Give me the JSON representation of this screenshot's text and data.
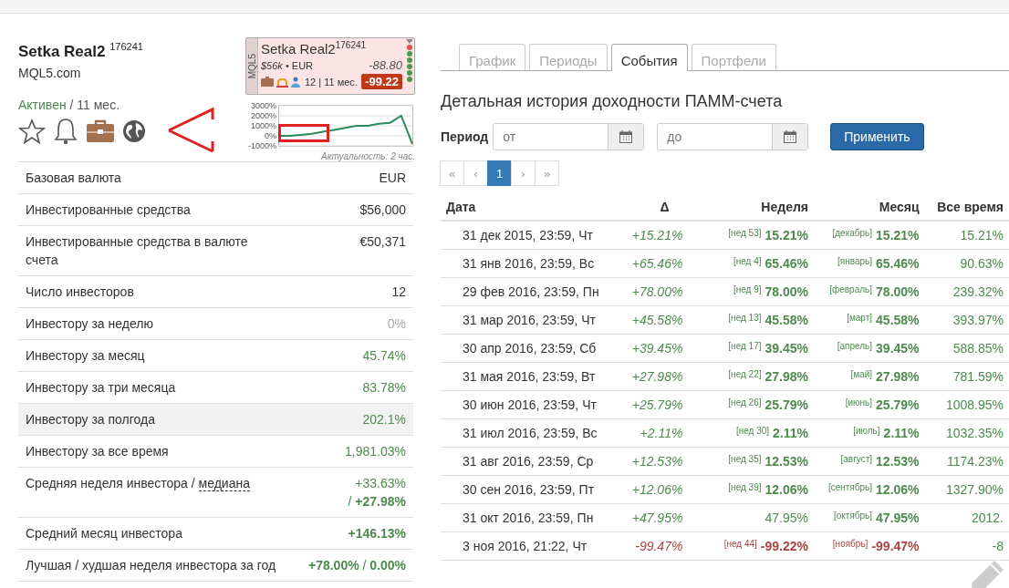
{
  "account": {
    "name": "Setka Real2",
    "number": "176241",
    "site": "MQL5.com",
    "status": "Активен",
    "age": " / 11 мес."
  },
  "widget": {
    "vendor": "MQL5",
    "name": "Setka Real2",
    "number": "176241",
    "funds": "$56k",
    "currency": " • EUR",
    "value": "-88.80",
    "investors": "12 | 11 мес.",
    "result": "-99.22",
    "signals": [
      {
        "color": "#d9534f"
      },
      {
        "color": "#4a9a4a"
      },
      {
        "color": "#4a9a4a"
      },
      {
        "color": "#4a9a4a"
      },
      {
        "color": "#4a9a4a"
      },
      {
        "color": "#4a9a4a"
      }
    ],
    "chart_data": {
      "type": "line",
      "yticks": [
        {
          "value": 3000,
          "label": "3000%"
        },
        {
          "value": 2000,
          "label": "2000%"
        },
        {
          "value": 1000,
          "label": "1000%"
        },
        {
          "value": 0,
          "label": "0%"
        },
        {
          "value": -1000,
          "label": "-1000%"
        }
      ],
      "ylim": [
        -1000,
        3000
      ],
      "grid": true,
      "series": [
        {
          "color": "#2e8b57",
          "values": [
            0,
            0,
            100,
            200,
            400,
            600,
            800,
            1000,
            1000,
            1200,
            1300,
            2000,
            -800
          ]
        }
      ]
    },
    "caption": "Актуальность: 2 час."
  },
  "stats": [
    {
      "label": "Базовая валюта",
      "value": "EUR",
      "kind": "plain",
      "highlighted": false
    },
    {
      "label": "Инвестированные средства",
      "value": "$56,000",
      "kind": "plain",
      "highlighted": false
    },
    {
      "label": "Инвестированные средства в валюте счета",
      "value": "€50,371",
      "kind": "plain",
      "highlighted": false
    },
    {
      "label": "Число инвесторов",
      "value": "12",
      "kind": "plain",
      "highlighted": false
    },
    {
      "label": "Инвестору за неделю",
      "value": "0%",
      "kind": "muted",
      "highlighted": false
    },
    {
      "label": "Инвестору за месяц",
      "value": "45.74%",
      "kind": "green",
      "highlighted": false
    },
    {
      "label": "Инвестору за три месяца",
      "value": "83.78%",
      "kind": "green",
      "highlighted": false
    },
    {
      "label": "Инвестору за полгода",
      "value": "202.1%",
      "kind": "green",
      "highlighted": true
    },
    {
      "label": "Инвестору за все время",
      "value": "1,981.03%",
      "kind": "green",
      "highlighted": false
    },
    {
      "label": "Средняя неделя инвестора / ",
      "link": "медиана",
      "value": "+33.63%",
      "value2": "/ **+27.98%**",
      "kind": "green",
      "highlighted": false
    },
    {
      "label": "Средний месяц инвестора",
      "value": "+146.13%",
      "kind": "strong",
      "highlighted": false
    },
    {
      "label": "Лучшая / худшая неделя инвестора за год",
      "value": "**+78.00%** / **0.00%**",
      "kind": "green",
      "highlighted": false
    }
  ],
  "tabs": [
    {
      "label": "График",
      "selected": false
    },
    {
      "label": "Периоды",
      "selected": false
    },
    {
      "label": "События",
      "selected": true
    },
    {
      "label": "Портфели",
      "selected": false
    }
  ],
  "heading": "Детальная история доходности ПАММ-счета",
  "period": {
    "label": "Период",
    "from_placeholder": "от",
    "to_placeholder": "до",
    "apply": "Применить"
  },
  "pagination": [
    {
      "label": "«",
      "selected": false
    },
    {
      "label": "‹",
      "selected": false
    },
    {
      "label": "1",
      "selected": true
    },
    {
      "label": "›",
      "selected": false
    },
    {
      "label": "»",
      "selected": false
    }
  ],
  "table": {
    "columns": [
      "Дата",
      "Δ",
      "Неделя",
      "Месяц",
      "Все время"
    ],
    "rows": [
      {
        "date": "31 дек 2015, 23:59, Чт",
        "delta": "+15.21%",
        "week_tag": "[нед 53]",
        "week": "15.21%",
        "month_tag": "[декабрь]",
        "month": "15.21%",
        "total": "15.21%",
        "negative": false
      },
      {
        "date": "31 янв 2016, 23:59, Вс",
        "delta": "+65.46%",
        "week_tag": "[нед 4]",
        "week": "65.46%",
        "month_tag": "[январь]",
        "month": "65.46%",
        "total": "90.63%",
        "negative": false
      },
      {
        "date": "29 фев 2016, 23:59, Пн",
        "delta": "+78.00%",
        "week_tag": "[нед 9]",
        "week": "78.00%",
        "month_tag": "[февраль]",
        "month": "78.00%",
        "total": "239.32%",
        "negative": false
      },
      {
        "date": "31 мар 2016, 23:59, Чт",
        "delta": "+45.58%",
        "week_tag": "[нед 13]",
        "week": "45.58%",
        "month_tag": "[март]",
        "month": "45.58%",
        "total": "393.97%",
        "negative": false
      },
      {
        "date": "30 апр 2016, 23:59, Сб",
        "delta": "+39.45%",
        "week_tag": "[нед 17]",
        "week": "39.45%",
        "month_tag": "[апрель]",
        "month": "39.45%",
        "total": "588.85%",
        "negative": false
      },
      {
        "date": "31 мая 2016, 23:59, Вт",
        "delta": "+27.98%",
        "week_tag": "[нед 22]",
        "week": "27.98%",
        "month_tag": "[май]",
        "month": "27.98%",
        "total": "781.59%",
        "negative": false
      },
      {
        "date": "30 июн 2016, 23:59, Чт",
        "delta": "+25.79%",
        "week_tag": "[нед 26]",
        "week": "25.79%",
        "month_tag": "[июнь]",
        "month": "25.79%",
        "total": "1008.95%",
        "negative": false
      },
      {
        "date": "31 июл 2016, 23:59, Вс",
        "delta": "+2.11%",
        "week_tag": "[нед 30]",
        "week": "2.11%",
        "month_tag": "[июль]",
        "month": "2.11%",
        "total": "1032.35%",
        "negative": false
      },
      {
        "date": "31 авг 2016, 23:59, Ср",
        "delta": "+12.53%",
        "week_tag": "[нед 35]",
        "week": "12.53%",
        "month_tag": "[август]",
        "month": "12.53%",
        "total": "1174.23%",
        "negative": false
      },
      {
        "date": "30 сен 2016, 23:59, Пт",
        "delta": "+12.06%",
        "week_tag": "[нед 39]",
        "week": "12.06%",
        "month_tag": "[сентябрь]",
        "month": "12.06%",
        "total": "1327.90%",
        "negative": false
      },
      {
        "date": "31 окт 2016, 23:59, Пн",
        "delta": "+47.95%",
        "week": "47.95%",
        "month_tag": "[октябрь]",
        "month": "47.95%",
        "total": "2012.",
        "negative": false
      },
      {
        "date": "3 ноя 2016, 21:22, Чт",
        "delta": "-99.47%",
        "week_tag": "[нед 44]",
        "week": "-99.22%",
        "month_tag": "[ноябрь]",
        "month": "-99.47%",
        "total": "-8",
        "negative": true
      }
    ]
  }
}
